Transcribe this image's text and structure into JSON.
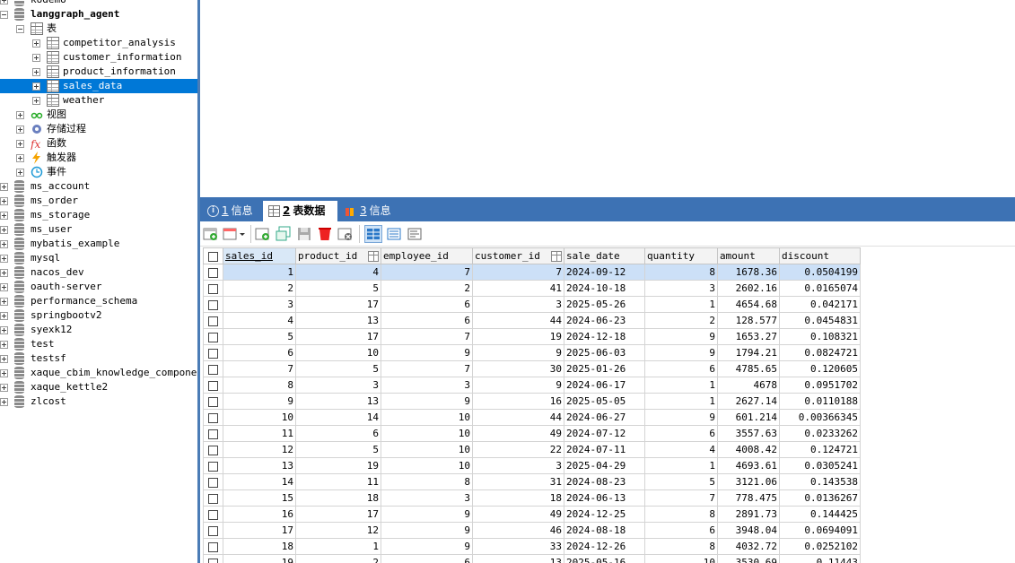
{
  "tree": [
    {
      "label": "kodemo",
      "kind": "db",
      "expanded": false
    },
    {
      "label": "langgraph_agent",
      "kind": "db",
      "expanded": true,
      "bold": true
    },
    {
      "label": "表",
      "kind": "folder-tables",
      "expanded": true
    },
    {
      "label": "competitor_analysis",
      "kind": "table"
    },
    {
      "label": "customer_information",
      "kind": "table"
    },
    {
      "label": "product_information",
      "kind": "table"
    },
    {
      "label": "sales_data",
      "kind": "table",
      "selected": true
    },
    {
      "label": "weather",
      "kind": "table"
    },
    {
      "label": "视图",
      "kind": "views"
    },
    {
      "label": "存储过程",
      "kind": "procedures"
    },
    {
      "label": "函数",
      "kind": "functions"
    },
    {
      "label": "触发器",
      "kind": "triggers"
    },
    {
      "label": "事件",
      "kind": "events"
    },
    {
      "label": "ms_account",
      "kind": "db"
    },
    {
      "label": "ms_order",
      "kind": "db"
    },
    {
      "label": "ms_storage",
      "kind": "db"
    },
    {
      "label": "ms_user",
      "kind": "db"
    },
    {
      "label": "mybatis_example",
      "kind": "db"
    },
    {
      "label": "mysql",
      "kind": "db"
    },
    {
      "label": "nacos_dev",
      "kind": "db"
    },
    {
      "label": "oauth-server",
      "kind": "db"
    },
    {
      "label": "performance_schema",
      "kind": "db"
    },
    {
      "label": "springbootv2",
      "kind": "db"
    },
    {
      "label": "syexk12",
      "kind": "db"
    },
    {
      "label": "test",
      "kind": "db"
    },
    {
      "label": "testsf",
      "kind": "db"
    },
    {
      "label": "xaque_cbim_knowledge_component",
      "kind": "db"
    },
    {
      "label": "xaque_kettle2",
      "kind": "db"
    },
    {
      "label": "zlcost",
      "kind": "db"
    }
  ],
  "tabs": [
    {
      "num": "1",
      "label": "信息",
      "icon": "info-icon"
    },
    {
      "num": "2",
      "label": "表数据",
      "icon": "table-grid-icon",
      "active": true
    },
    {
      "num": "3",
      "label": "信息",
      "icon": "bar-chart-icon"
    }
  ],
  "toolbar": [
    "insert-record-icon",
    "filter-dropdown-icon",
    "add-row-icon",
    "duplicate-row-icon",
    "save-icon",
    "delete-icon",
    "refresh-cancel-icon",
    "grid-view-icon",
    "form-view-icon",
    "text-view-icon"
  ],
  "grid": {
    "columns": [
      "sales_id",
      "product_id",
      "employee_id",
      "customer_id",
      "sale_date",
      "quantity",
      "amount",
      "discount"
    ],
    "rows": [
      [
        "1",
        "4",
        "7",
        "7",
        "2024-09-12",
        "8",
        "1678.36",
        "0.0504199"
      ],
      [
        "2",
        "5",
        "2",
        "41",
        "2024-10-18",
        "3",
        "2602.16",
        "0.0165074"
      ],
      [
        "3",
        "17",
        "6",
        "3",
        "2025-05-26",
        "1",
        "4654.68",
        "0.042171"
      ],
      [
        "4",
        "13",
        "6",
        "44",
        "2024-06-23",
        "2",
        "128.577",
        "0.0454831"
      ],
      [
        "5",
        "17",
        "7",
        "19",
        "2024-12-18",
        "9",
        "1653.27",
        "0.108321"
      ],
      [
        "6",
        "10",
        "9",
        "9",
        "2025-06-03",
        "9",
        "1794.21",
        "0.0824721"
      ],
      [
        "7",
        "5",
        "7",
        "30",
        "2025-01-26",
        "6",
        "4785.65",
        "0.120605"
      ],
      [
        "8",
        "3",
        "3",
        "9",
        "2024-06-17",
        "1",
        "4678",
        "0.0951702"
      ],
      [
        "9",
        "13",
        "9",
        "16",
        "2025-05-05",
        "1",
        "2627.14",
        "0.0110188"
      ],
      [
        "10",
        "14",
        "10",
        "44",
        "2024-06-27",
        "9",
        "601.214",
        "0.00366345"
      ],
      [
        "11",
        "6",
        "10",
        "49",
        "2024-07-12",
        "6",
        "3557.63",
        "0.0233262"
      ],
      [
        "12",
        "5",
        "10",
        "22",
        "2024-07-11",
        "4",
        "4008.42",
        "0.124721"
      ],
      [
        "13",
        "19",
        "10",
        "3",
        "2025-04-29",
        "1",
        "4693.61",
        "0.0305241"
      ],
      [
        "14",
        "11",
        "8",
        "31",
        "2024-08-23",
        "5",
        "3121.06",
        "0.143538"
      ],
      [
        "15",
        "18",
        "3",
        "18",
        "2024-06-13",
        "7",
        "778.475",
        "0.0136267"
      ],
      [
        "16",
        "17",
        "9",
        "49",
        "2024-12-25",
        "8",
        "2891.73",
        "0.144425"
      ],
      [
        "17",
        "12",
        "9",
        "46",
        "2024-08-18",
        "6",
        "3948.04",
        "0.0694091"
      ],
      [
        "18",
        "1",
        "9",
        "33",
        "2024-12-26",
        "8",
        "4032.72",
        "0.0252102"
      ],
      [
        "19",
        "2",
        "6",
        "13",
        "2025-05-16",
        "10",
        "3530.69",
        "0.11443"
      ]
    ]
  }
}
